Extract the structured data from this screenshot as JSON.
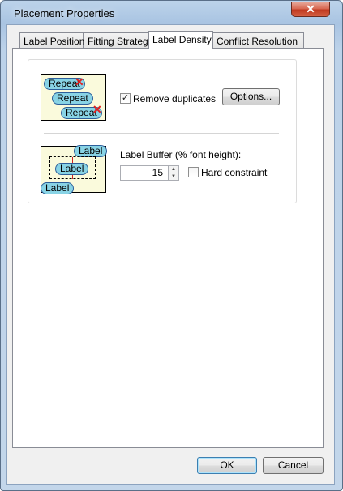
{
  "window": {
    "title": "Placement Properties",
    "close_glyph": "✕"
  },
  "tabs": [
    {
      "label": "Label Position"
    },
    {
      "label": "Fitting Strategy"
    },
    {
      "label": "Label Density",
      "active": true
    },
    {
      "label": "Conflict Resolution"
    }
  ],
  "duplicates": {
    "preview_labels": [
      "Repeat",
      "Repeat",
      "Repeat"
    ],
    "x_mark": "✕",
    "checkbox_label": "Remove duplicates",
    "checked": true,
    "check_glyph": "✓",
    "options_button": "Options..."
  },
  "buffer": {
    "preview_labels": [
      "Label",
      "Label",
      "Label"
    ],
    "title": "Label Buffer (% font height):",
    "value": "15",
    "hard_constraint_label": "Hard constraint",
    "hard_constraint_checked": false
  },
  "footer": {
    "ok": "OK",
    "cancel": "Cancel"
  }
}
